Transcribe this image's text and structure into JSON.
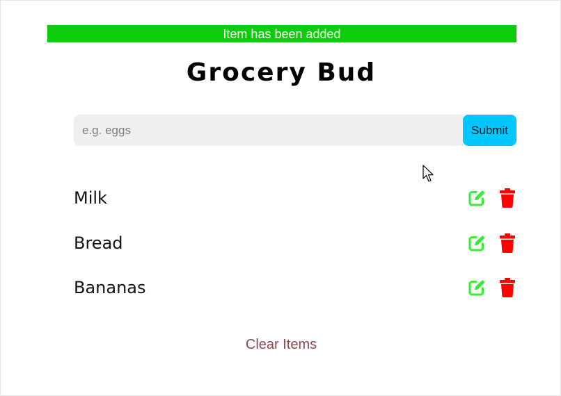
{
  "alert": {
    "text": "Item has been added",
    "color": "#0ccc0c"
  },
  "title": "Grocery Bud",
  "form": {
    "placeholder": "e.g. eggs",
    "value": "",
    "submit_label": "Submit",
    "submit_color": "#00c8ff"
  },
  "items": [
    {
      "name": "Milk"
    },
    {
      "name": "Bread"
    },
    {
      "name": "Bananas"
    }
  ],
  "icons": {
    "edit": "edit-icon",
    "delete": "trash-icon",
    "edit_color": "#33ee33",
    "delete_color": "#ff0000"
  },
  "clear_label": "Clear Items",
  "clear_color": "#8a4a4a"
}
